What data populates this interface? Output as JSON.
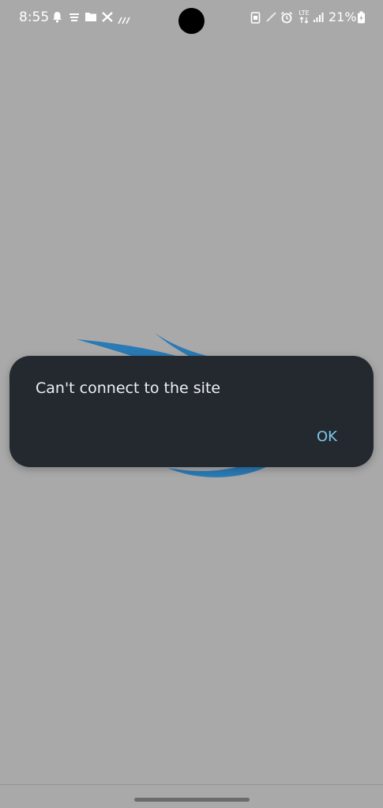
{
  "status_bar": {
    "time": "8:55",
    "battery_percent": "21%",
    "network_type": "LTE",
    "icons": [
      "notification-bell-icon",
      "app-notification-icon",
      "folder-icon",
      "tools-icon",
      "wifi-calling-icon",
      "screenshot-icon",
      "pen-icon",
      "alarm-icon",
      "lte-icon",
      "signal-icon",
      "battery-charging-icon"
    ]
  },
  "dialog": {
    "message": "Can't connect to the site",
    "ok_label": "OK"
  },
  "colors": {
    "scrim": "#a9a9a9",
    "dialog_bg": "#242930",
    "dialog_text": "#eef0f2",
    "accent": "#7cc8ec",
    "logo_blue": "#2a7ab5"
  }
}
